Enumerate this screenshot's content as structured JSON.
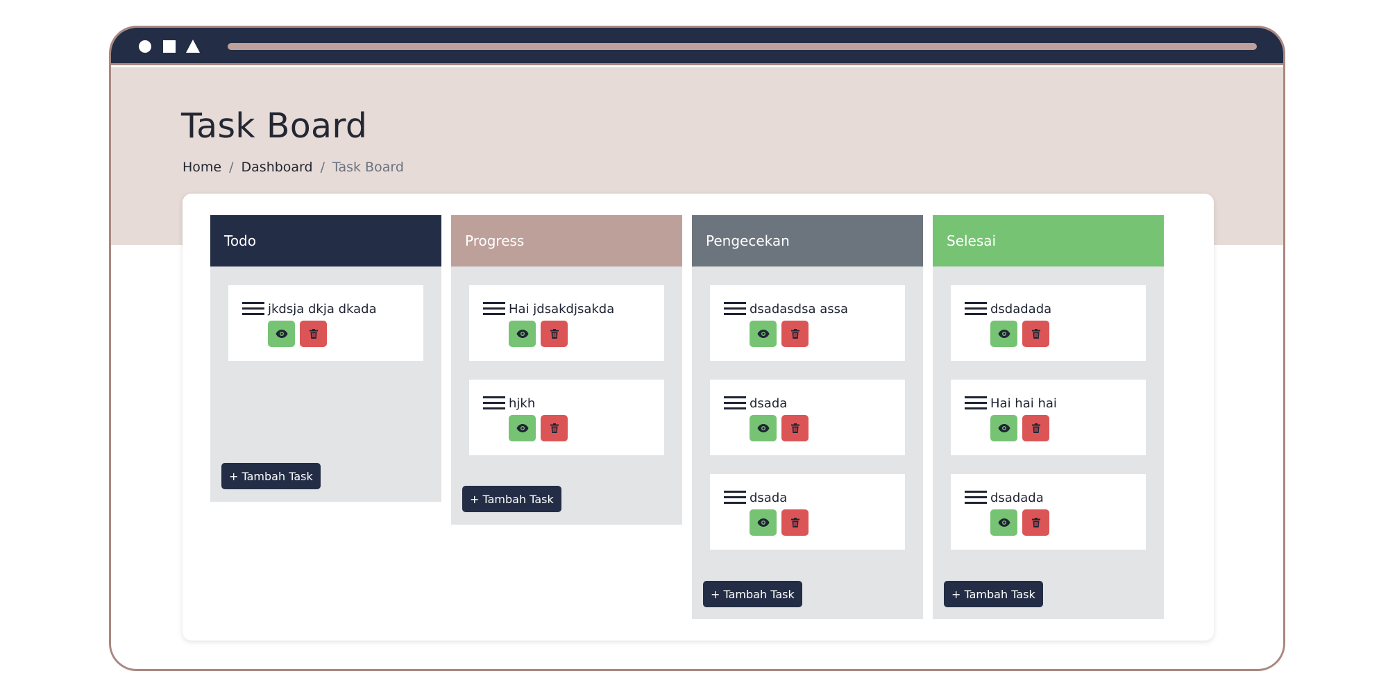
{
  "page": {
    "title": "Task Board",
    "breadcrumb": [
      "Home",
      "Dashboard",
      "Task Board"
    ]
  },
  "colors": {
    "topbar": "#232d45",
    "frame_border": "#a98880",
    "hero_bg": "#e6dbd6",
    "column_bg": "#e3e4e6",
    "view_button": "#77c374",
    "delete_button": "#dc5556",
    "add_button": "#232d45"
  },
  "icons": {
    "drag": "hamburger-icon",
    "view": "eye-icon",
    "delete": "trash-icon"
  },
  "columns": [
    {
      "name": "Todo",
      "header_color": "#232d45",
      "tasks": [
        {
          "title": "jkdsja dkja dkada"
        }
      ],
      "add_label": "+ Tambah Task"
    },
    {
      "name": "Progress",
      "header_color": "#bea09a",
      "tasks": [
        {
          "title": "Hai jdsakdjsakda"
        },
        {
          "title": "hjkh"
        }
      ],
      "add_label": "+ Tambah Task"
    },
    {
      "name": "Pengecekan",
      "header_color": "#6c757d",
      "tasks": [
        {
          "title": "dsadasdsa assa"
        },
        {
          "title": "dsada"
        },
        {
          "title": "dsada"
        }
      ],
      "add_label": "+ Tambah Task"
    },
    {
      "name": "Selesai",
      "header_color": "#77c374",
      "tasks": [
        {
          "title": "dsdadada"
        },
        {
          "title": "Hai hai hai"
        },
        {
          "title": "dsadada"
        }
      ],
      "add_label": "+ Tambah Task"
    }
  ]
}
